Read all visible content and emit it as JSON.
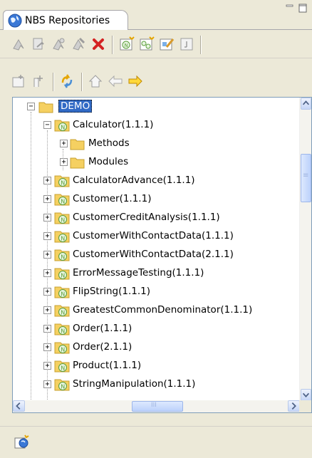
{
  "view": {
    "title": "NBS Repositories",
    "tab_icon": "globe-icon",
    "minimize_icon": "minimize-icon",
    "maximize_icon": "maximize-icon"
  },
  "toolbar_primary": [
    {
      "name": "checkout-icon"
    },
    {
      "name": "checkin-icon"
    },
    {
      "name": "sync-icon"
    },
    {
      "name": "lock-icon"
    },
    {
      "name": "delete-icon"
    },
    {
      "name": "new-node-icon"
    },
    {
      "name": "new-multi-node-icon"
    },
    {
      "name": "edit-properties-icon"
    },
    {
      "name": "panel-icon"
    }
  ],
  "toolbar_secondary": [
    {
      "name": "new-folder-icon"
    },
    {
      "name": "new-entry-icon"
    },
    {
      "name": "refresh-icon"
    },
    {
      "name": "home-icon"
    },
    {
      "name": "back-arrow-icon"
    },
    {
      "name": "forward-arrow-icon"
    }
  ],
  "tree": {
    "root": {
      "label": "DEMO",
      "expanded": true,
      "selected": true
    },
    "items": [
      {
        "label": "Calculator(1.1.1)",
        "expanded": true,
        "children": [
          {
            "label": "Methods"
          },
          {
            "label": "Modules"
          }
        ]
      },
      {
        "label": "CalculatorAdvance(1.1.1)"
      },
      {
        "label": "Customer(1.1.1)"
      },
      {
        "label": "CustomerCreditAnalysis(1.1.1)"
      },
      {
        "label": "CustomerWithContactData(1.1.1)"
      },
      {
        "label": "CustomerWithContactData(2.1.1)"
      },
      {
        "label": "ErrorMessageTesting(1.1.1)"
      },
      {
        "label": "FlipString(1.1.1)"
      },
      {
        "label": "GreatestCommonDenominator(1.1.1)"
      },
      {
        "label": "Order(1.1.1)"
      },
      {
        "label": "Order(2.1.1)"
      },
      {
        "label": "Product(1.1.1)"
      },
      {
        "label": "StringManipulation(1.1.1)"
      }
    ],
    "expand_glyph": "+",
    "collapse_glyph": "−",
    "hscroll_thumb_glyph": "III",
    "vscroll_thumb_glyph": "≡"
  },
  "status": {
    "icon": "repository-connect-icon"
  },
  "colors": {
    "selection": "#316ac5",
    "folder": "#f5d061",
    "node_green": "#5a9e3a",
    "background": "#ece9d8"
  }
}
